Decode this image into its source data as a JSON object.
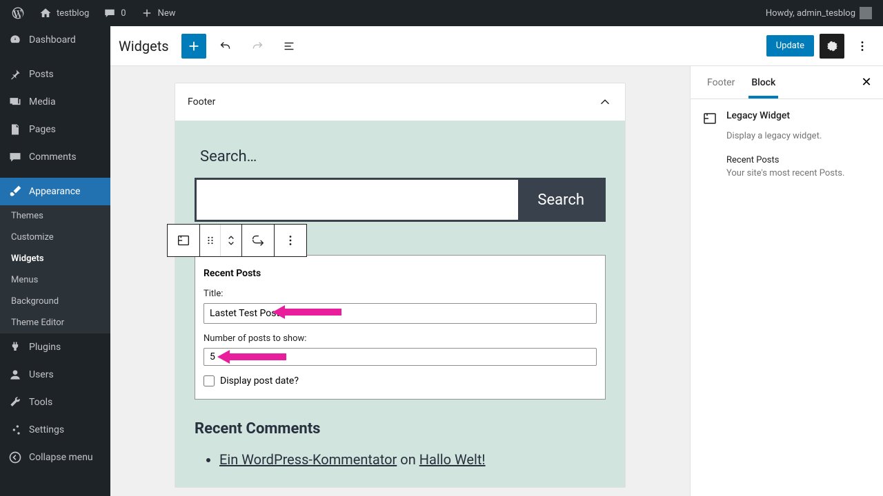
{
  "adminBar": {
    "siteName": "testblog",
    "commentCount": "0",
    "newLabel": "New",
    "howdy": "Howdy, admin_tesblog"
  },
  "menu": {
    "dashboard": "Dashboard",
    "posts": "Posts",
    "media": "Media",
    "pages": "Pages",
    "comments": "Comments",
    "appearance": "Appearance",
    "plugins": "Plugins",
    "users": "Users",
    "tools": "Tools",
    "settings": "Settings",
    "collapse": "Collapse menu",
    "sub": {
      "themes": "Themes",
      "customize": "Customize",
      "widgets": "Widgets",
      "menus": "Menus",
      "background": "Background",
      "themeEditor": "Theme Editor"
    }
  },
  "header": {
    "title": "Widgets",
    "update": "Update"
  },
  "canvas": {
    "areaTitle": "Footer",
    "search": {
      "label": "Search…",
      "button": "Search"
    },
    "recentPosts": {
      "header": "Recent Posts",
      "titleLabel": "Title:",
      "titleValue": "Lastet Test Posts",
      "numLabel": "Number of posts to show:",
      "numValue": "5",
      "dateLabel": "Display post date?"
    },
    "recentComments": {
      "header": "Recent Comments",
      "author": "Ein WordPress-Kommentator",
      "on": " on ",
      "post": "Hallo Welt!"
    }
  },
  "sidebar": {
    "tabFooter": "Footer",
    "tabBlock": "Block",
    "blockTitle": "Legacy Widget",
    "blockDesc": "Display a legacy widget.",
    "widgetTitle": "Recent Posts",
    "widgetDesc": "Your site's most recent Posts."
  }
}
